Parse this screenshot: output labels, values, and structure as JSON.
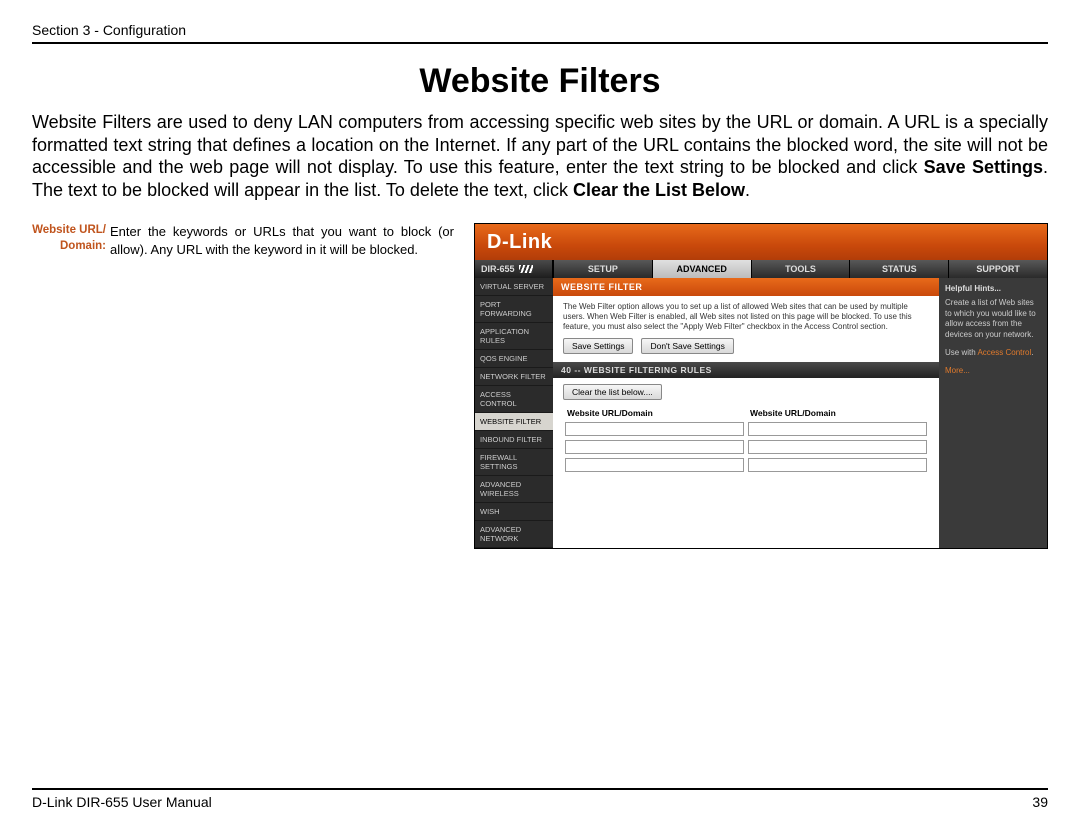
{
  "header": {
    "section": "Section 3 - Configuration"
  },
  "title": "Website Filters",
  "paragraph": {
    "p1": "Website Filters are used to deny LAN computers from accessing specific web sites by the URL or domain. A URL is a specially formatted text string that defines a location on the Internet. If any part of the URL contains the blocked word, the site will not be accessible and the web page will not display. To use this feature, enter the text string to be blocked and click ",
    "b1": "Save Settings",
    "p2": ". The text to be blocked will appear in the list. To delete the text, click ",
    "b2": "Clear the List Below",
    "p3": "."
  },
  "definition": {
    "term": "Website URL/ Domain:",
    "desc": "Enter the keywords or URLs that you want to block (or allow). Any URL with the keyword in it will be blocked."
  },
  "screenshot": {
    "logo": "D-Link",
    "model": "DIR-655",
    "tabs": [
      "SETUP",
      "ADVANCED",
      "TOOLS",
      "STATUS",
      "SUPPORT"
    ],
    "activeTabIndex": 1,
    "sidebar": [
      "VIRTUAL SERVER",
      "PORT FORWARDING",
      "APPLICATION RULES",
      "QOS ENGINE",
      "NETWORK FILTER",
      "ACCESS CONTROL",
      "WEBSITE FILTER",
      "INBOUND FILTER",
      "FIREWALL SETTINGS",
      "ADVANCED WIRELESS",
      "WISH",
      "ADVANCED NETWORK"
    ],
    "sidebarActiveIndex": 6,
    "panel": {
      "title": "WEBSITE FILTER",
      "desc": "The Web Filter option allows you to set up a list of allowed Web sites that can be used by multiple users. When Web Filter is enabled, all Web sites not listed on this page will be blocked. To use this feature, you must also select the \"Apply Web Filter\" checkbox in the Access Control section.",
      "save": "Save Settings",
      "dontsave": "Don't Save Settings",
      "rulesTitle": "40 -- WEBSITE FILTERING RULES",
      "clear": "Clear the list below....",
      "col": "Website URL/Domain"
    },
    "hints": {
      "title": "Helpful Hints...",
      "body1": "Create a list of Web sites to which you would like to allow access from the devices on your network.",
      "body2a": "Use with ",
      "body2b": "Access Control",
      "more": "More..."
    }
  },
  "footer": {
    "left": "D-Link DIR-655 User Manual",
    "right": "39"
  }
}
